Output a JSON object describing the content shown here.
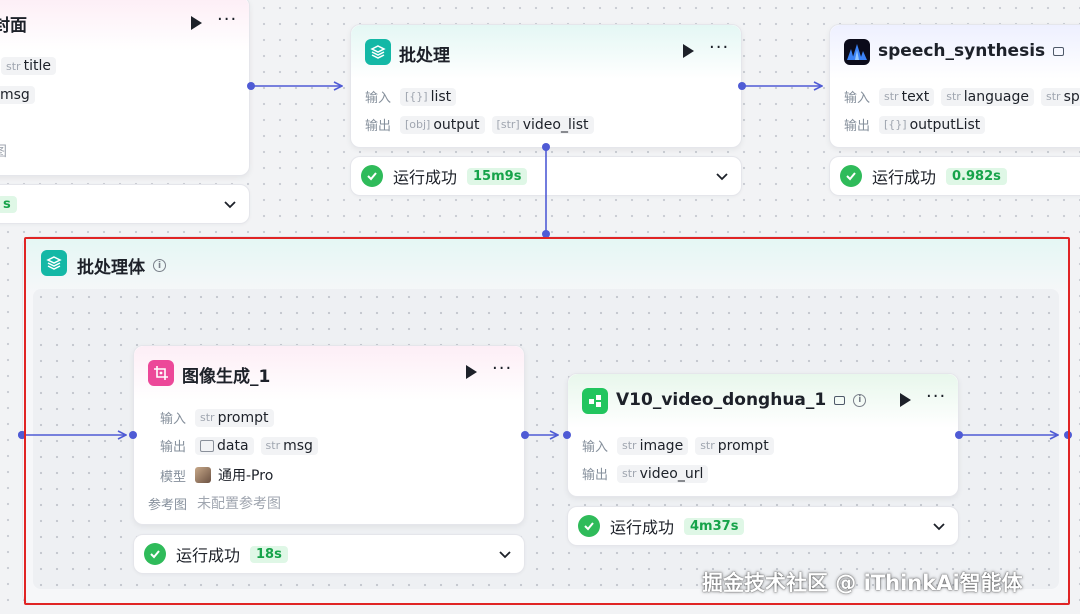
{
  "labels": {
    "input": "输入",
    "output": "输出",
    "model": "模型",
    "ref_image": "参考图",
    "str": "str"
  },
  "colors": {
    "edge": "#4f5bd5",
    "success": "#2fbb5a",
    "highlight": "#e02424",
    "teal": "#14b8a6",
    "pink": "#ec4899",
    "green": "#22c55e"
  },
  "left_node": {
    "title_partial": "封面",
    "outputs": [
      "title",
      "msg"
    ],
    "ref_partial": "图",
    "status_time_partial": "s"
  },
  "batch_node": {
    "title": "批处理",
    "icon": "layers-icon",
    "inputs": [
      {
        "name": "list",
        "type": "[{}]"
      }
    ],
    "outputs": [
      {
        "name": "output",
        "type": "[obj]"
      },
      {
        "name": "video_list",
        "type": "[str]"
      }
    ],
    "status": "运行成功",
    "time": "15m9s"
  },
  "speech_node": {
    "title": "speech_synthesis",
    "icon": "waveform-logo-icon",
    "inputs": [
      "text",
      "language",
      "speak"
    ],
    "outputs": [
      {
        "name": "outputList",
        "type": "[{}]"
      }
    ],
    "status": "运行成功",
    "time": "0.982s"
  },
  "group": {
    "title": "批处理体",
    "icon": "layers-icon"
  },
  "image_node": {
    "title": "图像生成_1",
    "icon": "image-crop-icon",
    "inputs": [
      "prompt"
    ],
    "outputs": [
      {
        "name": "data",
        "type": "image"
      },
      {
        "name": "msg",
        "type": "str"
      }
    ],
    "model": "通用-Pro",
    "ref_value": "未配置参考图",
    "status": "运行成功",
    "time": "18s"
  },
  "video_node": {
    "title": "V10_video_donghua_1",
    "icon": "plugin-blocks-icon",
    "inputs": [
      "image",
      "prompt"
    ],
    "outputs": [
      "video_url"
    ],
    "status": "运行成功",
    "time": "4m37s"
  },
  "watermark": "掘金技术社区 @ iThinkAi智能体"
}
